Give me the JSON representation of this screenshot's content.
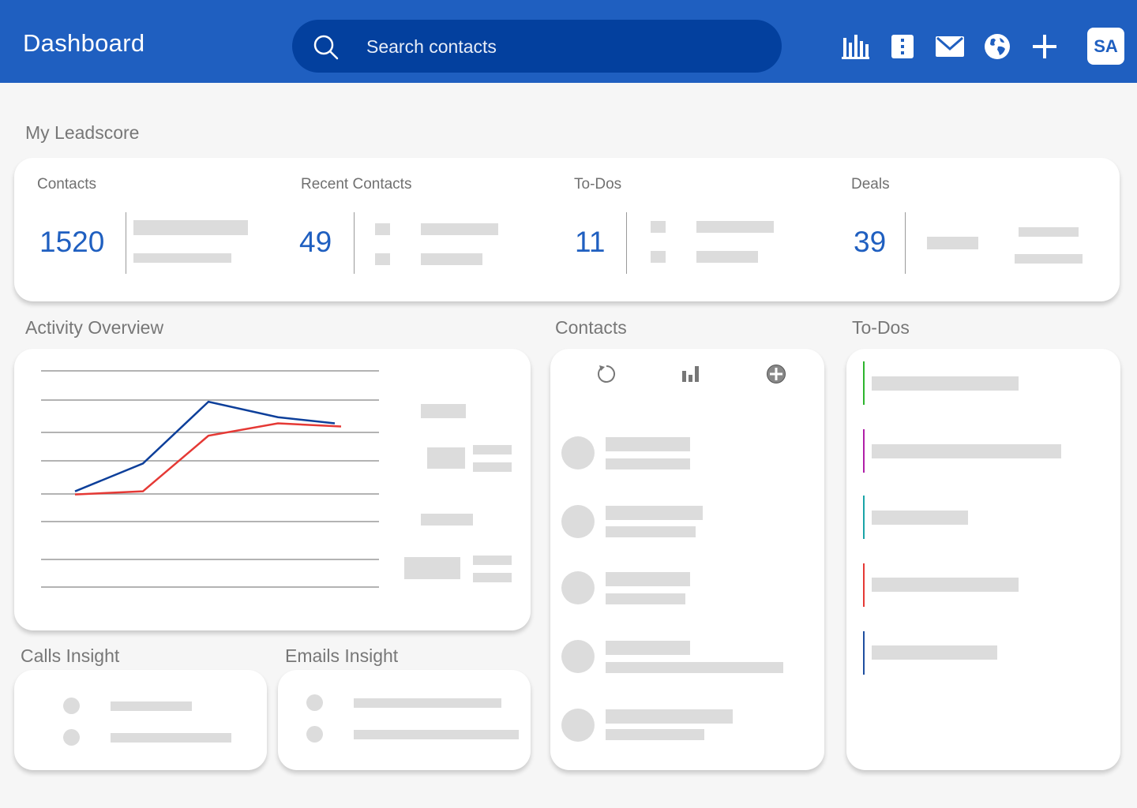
{
  "header": {
    "title": "Dashboard",
    "search_placeholder": "Search contacts",
    "icons": [
      "bar-chart-icon",
      "contact-book-icon",
      "mail-icon",
      "globe-icon",
      "plus-icon"
    ],
    "avatar_initials": "SA",
    "accent_color": "#1f5fc0"
  },
  "leadscore": {
    "title": "My Leadscore",
    "kpis": [
      {
        "label": "Contacts",
        "value": "1520"
      },
      {
        "label": "Recent Contacts",
        "value": "49"
      },
      {
        "label": "To-Dos",
        "value": "11"
      },
      {
        "label": "Deals",
        "value": "39"
      }
    ]
  },
  "activity": {
    "title": "Activity Overview"
  },
  "contacts": {
    "title": "Contacts",
    "toolbar_icons": [
      "refresh-icon",
      "bar-chart-icon",
      "add-circle-icon"
    ]
  },
  "todos": {
    "title": "To-Dos",
    "accent_colors": [
      "#2db52d",
      "#b01fa8",
      "#1aa4a8",
      "#e53935",
      "#1f4fa0"
    ]
  },
  "calls_insight": {
    "title": "Calls Insight"
  },
  "emails_insight": {
    "title": "Emails Insight"
  },
  "chart_data": {
    "type": "line",
    "x": [
      1,
      2,
      3,
      4,
      5
    ],
    "series": [
      {
        "color": "#0d3f9a",
        "values": [
          3.1,
          4.0,
          6.0,
          5.5,
          5.3
        ]
      },
      {
        "color": "#e53935",
        "values": [
          3.0,
          3.1,
          4.9,
          5.3,
          5.2
        ]
      }
    ],
    "ylim": [
      0,
      7
    ],
    "grid": true
  }
}
